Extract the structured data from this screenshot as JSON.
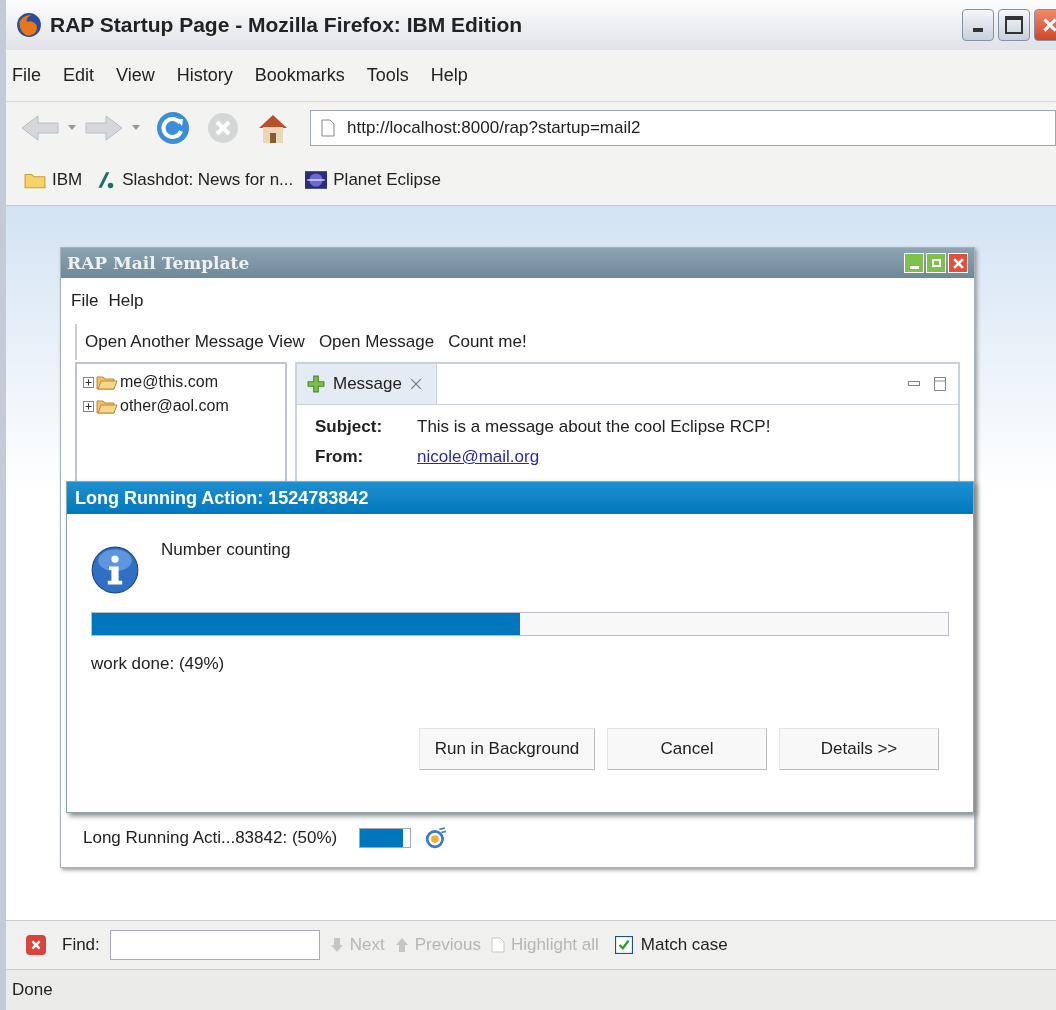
{
  "window": {
    "title": "RAP Startup Page - Mozilla Firefox: IBM Edition"
  },
  "menu": [
    "File",
    "Edit",
    "View",
    "History",
    "Bookmarks",
    "Tools",
    "Help"
  ],
  "address": {
    "value": "http://localhost:8000/rap?startup=mail2"
  },
  "bookmarks": [
    {
      "label": "IBM",
      "kind": "folder"
    },
    {
      "label": "Slashdot: News for n...",
      "kind": "slashdot"
    },
    {
      "label": "Planet Eclipse",
      "kind": "eclipse"
    }
  ],
  "app": {
    "title": "RAP Mail Template",
    "menu": [
      "File",
      "Help"
    ],
    "toolbar": [
      "Open Another Message View",
      "Open Message",
      "Count me!"
    ],
    "tree": [
      {
        "label": "me@this.com",
        "expanded": false
      },
      {
        "label": "other@aol.com",
        "expanded": false
      }
    ],
    "tabs": [
      {
        "label": "Message",
        "selected": true
      }
    ],
    "message": {
      "fields": [
        {
          "label": "Subject:",
          "value": "This is a message about the cool Eclipse RCP!",
          "kind": "text"
        },
        {
          "label": "From:",
          "value": "nicole@mail.org",
          "kind": "link"
        }
      ]
    },
    "status": {
      "text": "Long Running Acti...83842: (50%)",
      "level": 0.85
    }
  },
  "dialog": {
    "title": "Long Running Action: 1524783842",
    "message": "Number counting",
    "progress": {
      "level": 0.5
    },
    "detail": "work done: (49%)",
    "buttons": [
      "Run in Background",
      "Cancel",
      "Details >>"
    ]
  },
  "find_bar": {
    "label": "Find:",
    "actions": [
      {
        "label": "Next",
        "disabled": true,
        "kind": "down"
      },
      {
        "label": "Previous",
        "disabled": true,
        "kind": "up"
      },
      {
        "label": "Highlight all",
        "disabled": true,
        "kind": "page"
      }
    ],
    "match_case": {
      "label": "Match case",
      "checked": true
    }
  },
  "status_bar": "Done"
}
